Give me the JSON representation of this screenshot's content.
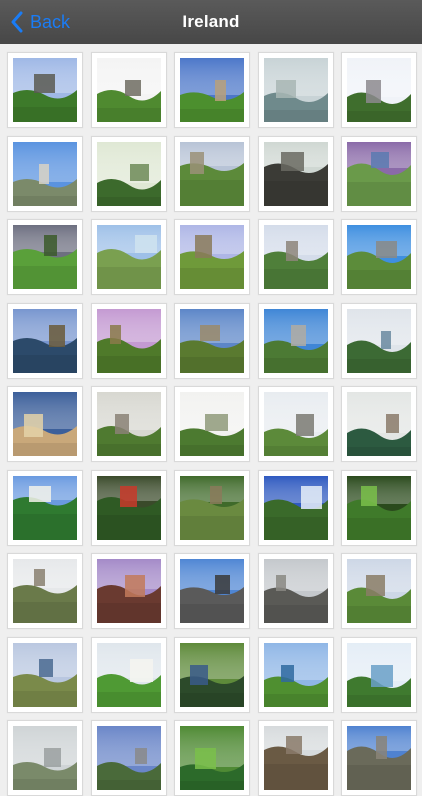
{
  "navbar": {
    "back_label": "Back",
    "title": "Ireland",
    "accent": "#1a7cf5",
    "bar_color": "#4f4f4f"
  },
  "gallery": {
    "photos": [
      {
        "scene": "cliff-castle",
        "sky": "#9fb8e6",
        "ground": "#3d7a2a",
        "accent": "#5a5a52"
      },
      {
        "scene": "stone-abbey",
        "sky": "#f4f4f4",
        "ground": "#4f8a30",
        "accent": "#6e6c62"
      },
      {
        "scene": "manor-house",
        "sky": "#4c77c9",
        "ground": "#4c8f2e",
        "accent": "#b9a07a"
      },
      {
        "scene": "sea-cliffs-mist",
        "sky": "#c8d3d6",
        "ground": "#6f8a8c",
        "accent": "#a8b6b4"
      },
      {
        "scene": "cathedral-spires",
        "sky": "#f0f3f8",
        "ground": "#3f6e2d",
        "accent": "#8c8a8e"
      },
      {
        "scene": "city-dome",
        "sky": "#5a93e0",
        "ground": "#7b8a6a",
        "accent": "#d8d2c4"
      },
      {
        "scene": "green-ruins",
        "sky": "#dfe8d4",
        "ground": "#3c6a2c",
        "accent": "#6d8a58"
      },
      {
        "scene": "country-house",
        "sky": "#b7c3d6",
        "ground": "#5c8a3a",
        "accent": "#9a9078"
      },
      {
        "scene": "stone-arch",
        "sky": "#cfd7d2",
        "ground": "#3b3b36",
        "accent": "#6a6a62"
      },
      {
        "scene": "bay-dusk",
        "sky": "#8a6aa8",
        "ground": "#6a9a4a",
        "accent": "#5a7ab0"
      },
      {
        "scene": "stormy-field",
        "sky": "#6d6f80",
        "ground": "#5aa03a",
        "accent": "#3b5a2a"
      },
      {
        "scene": "coast-surf",
        "sky": "#9ec0e8",
        "ground": "#7aa050",
        "accent": "#cfe3ef"
      },
      {
        "scene": "standing-stones",
        "sky": "#aeb6e6",
        "ground": "#6f9a3a",
        "accent": "#8a7a5a"
      },
      {
        "scene": "castle-keep",
        "sky": "#d4dcea",
        "ground": "#4f7f3a",
        "accent": "#8d857a"
      },
      {
        "scene": "dolmen",
        "sky": "#3f8fe0",
        "ground": "#5c8c3a",
        "accent": "#8a8a86"
      },
      {
        "scene": "lake-castle",
        "sky": "#7896cf",
        "ground": "#2c4a6a",
        "accent": "#6a5a3a"
      },
      {
        "scene": "cliff-valley",
        "sky": "#c49ad2",
        "ground": "#4f7a2a",
        "accent": "#8a7a4a"
      },
      {
        "scene": "mountain-rocks",
        "sky": "#5c86c8",
        "ground": "#5a7a30",
        "accent": "#9a8a6a"
      },
      {
        "scene": "round-tower",
        "sky": "#3f86d6",
        "ground": "#4c7a34",
        "accent": "#b0aca2"
      },
      {
        "scene": "moher-cliffs",
        "sky": "#dfe4ea",
        "ground": "#3c6a34",
        "accent": "#6a8aa0"
      },
      {
        "scene": "columned-hall",
        "sky": "#3c5f9a",
        "ground": "#c9a87a",
        "accent": "#e4d2a8"
      },
      {
        "scene": "stone-steps",
        "sky": "#d7d7d0",
        "ground": "#4f7a30",
        "accent": "#8a8176"
      },
      {
        "scene": "ivy-college",
        "sky": "#f2f2f0",
        "ground": "#4c7a30",
        "accent": "#8f9a7a"
      },
      {
        "scene": "obelisk",
        "sky": "#e8ecf0",
        "ground": "#5c8a3a",
        "accent": "#7a7a72"
      },
      {
        "scene": "sea-stack",
        "sky": "#e3e6e4",
        "ground": "#2c5a40",
        "accent": "#8a7a6a"
      },
      {
        "scene": "grand-hotel",
        "sky": "#6a9ae0",
        "ground": "#2f7a30",
        "accent": "#f2f2ea"
      },
      {
        "scene": "red-bridge",
        "sky": "#3a4a2a",
        "ground": "#2f5a24",
        "accent": "#c83a2a"
      },
      {
        "scene": "forest-path",
        "sky": "#3f6a2a",
        "ground": "#6a8a40",
        "accent": "#8a7a5a"
      },
      {
        "scene": "lighthouse-bay",
        "sky": "#2f5ac0",
        "ground": "#3a6a2a",
        "accent": "#e6eef8"
      },
      {
        "scene": "ferns",
        "sky": "#2a4a1c",
        "ground": "#3f7a2a",
        "accent": "#7ac04a"
      },
      {
        "scene": "hill-fort",
        "sky": "#e6e8ea",
        "ground": "#6a7a4a",
        "accent": "#8a8070"
      },
      {
        "scene": "red-church",
        "sky": "#a48ac8",
        "ground": "#6a3a30",
        "accent": "#c27a5a"
      },
      {
        "scene": "statue-monument",
        "sky": "#4f86d4",
        "ground": "#5a5a5a",
        "accent": "#3a3a3a"
      },
      {
        "scene": "stone-building",
        "sky": "#c4c8cc",
        "ground": "#5a5a56",
        "accent": "#8a8882"
      },
      {
        "scene": "ruin-landscape",
        "sky": "#cdd7e6",
        "ground": "#5a8a38",
        "accent": "#8a7c66"
      },
      {
        "scene": "estuary",
        "sky": "#b9c7e0",
        "ground": "#7a8a4a",
        "accent": "#4a6a90"
      },
      {
        "scene": "horse-field",
        "sky": "#dfe6ec",
        "ground": "#4f9a34",
        "accent": "#f4f4f0"
      },
      {
        "scene": "river-rapids",
        "sky": "#5e8a3a",
        "ground": "#2c4a2a",
        "accent": "#3a5a8a"
      },
      {
        "scene": "green-headland",
        "sky": "#8fb6e6",
        "ground": "#4f8f30",
        "accent": "#2f6aa0"
      },
      {
        "scene": "coastal-bluff",
        "sky": "#e4edf6",
        "ground": "#3f7a2f",
        "accent": "#6aa0c8"
      },
      {
        "scene": "partial-1",
        "sky": "#cfd4d6",
        "ground": "#7a8a6a",
        "accent": "#9aa0a0"
      },
      {
        "scene": "partial-2",
        "sky": "#6a86c8",
        "ground": "#4a6a3a",
        "accent": "#8a8a8a"
      },
      {
        "scene": "partial-3",
        "sky": "#4f8a34",
        "ground": "#2c6a2a",
        "accent": "#7ac04a"
      },
      {
        "scene": "partial-4",
        "sky": "#d6dadc",
        "ground": "#6a5a44",
        "accent": "#8a7a6a"
      },
      {
        "scene": "partial-5",
        "sky": "#4f82d0",
        "ground": "#6a6a5a",
        "accent": "#8a8478"
      }
    ]
  }
}
